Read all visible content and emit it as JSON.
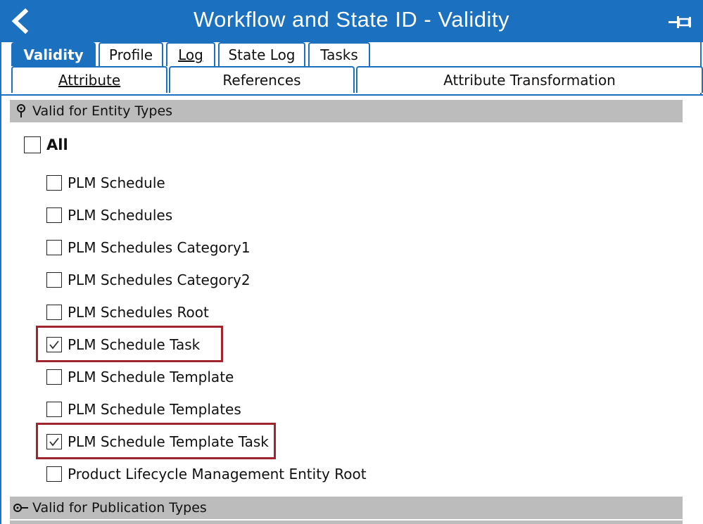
{
  "window": {
    "title": "Workflow and State ID - Validity",
    "accent_color": "#1c70c0",
    "back_icon": "chevron-left-icon",
    "pin_icon": "pin-icon"
  },
  "tabs_row1": [
    {
      "label": "Validity",
      "active": true
    },
    {
      "label": "Profile",
      "active": false
    },
    {
      "label": "Log",
      "active": false
    },
    {
      "label": "State Log",
      "active": false
    },
    {
      "label": "Tasks",
      "active": false
    }
  ],
  "tabs_row2": [
    {
      "label": "Attribute"
    },
    {
      "label": "References"
    },
    {
      "label": "Attribute Transformation"
    }
  ],
  "groups": {
    "entity_types": {
      "label": "Valid for Entity Types",
      "expanded": true,
      "all_label": "All",
      "all_checked": false,
      "items": [
        {
          "label": "PLM Schedule",
          "checked": false,
          "highlighted": false
        },
        {
          "label": "PLM Schedules",
          "checked": false,
          "highlighted": false
        },
        {
          "label": "PLM Schedules Category1",
          "checked": false,
          "highlighted": false
        },
        {
          "label": "PLM Schedules Category2",
          "checked": false,
          "highlighted": false
        },
        {
          "label": "PLM Schedules Root",
          "checked": false,
          "highlighted": false
        },
        {
          "label": "PLM Schedule Task",
          "checked": true,
          "highlighted": true
        },
        {
          "label": "PLM Schedule Template",
          "checked": false,
          "highlighted": false
        },
        {
          "label": "PLM Schedule Templates",
          "checked": false,
          "highlighted": false
        },
        {
          "label": "PLM Schedule Template Task",
          "checked": true,
          "highlighted": true
        },
        {
          "label": "Product Lifecycle Management Entity Root",
          "checked": false,
          "highlighted": false
        }
      ]
    },
    "publication_types": {
      "label": "Valid for Publication Types",
      "expanded": false
    }
  },
  "highlight_color": "#a0252f"
}
